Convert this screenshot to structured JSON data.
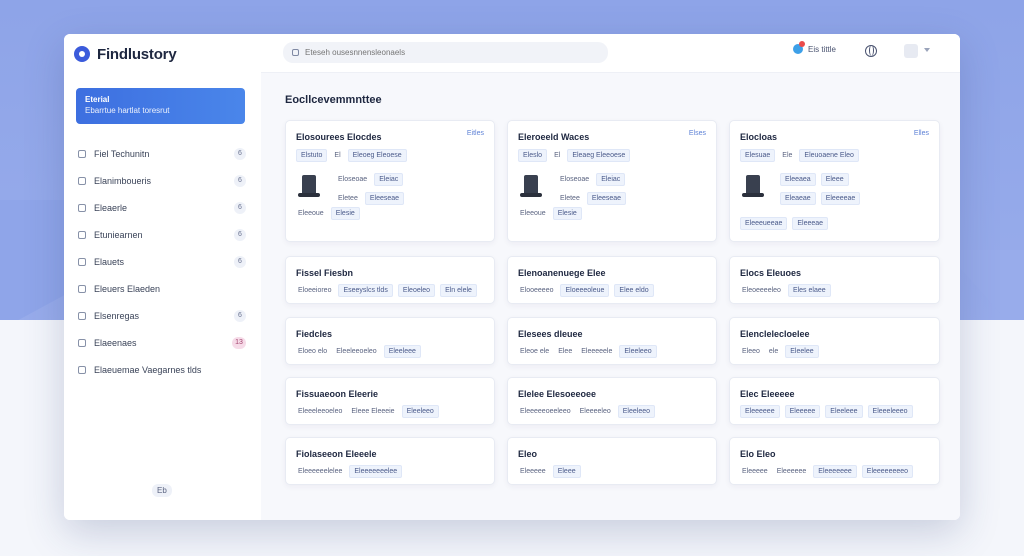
{
  "app": {
    "name": "Findlustory"
  },
  "sidebar": {
    "promo": {
      "title": "Eterial",
      "subtitle": "Ebarrtue hartlat toresrut"
    },
    "items": [
      {
        "label": "Fiel Techunitn",
        "count": "6"
      },
      {
        "label": "Elanimboueris",
        "count": "6"
      },
      {
        "label": "Eleaerle",
        "count": "6"
      },
      {
        "label": "Etuniearnen",
        "count": "6"
      },
      {
        "label": "Elauets",
        "count": "6"
      },
      {
        "label": "Eleuers Elaeden",
        "count": ""
      },
      {
        "label": "Elsenregas",
        "count": "6"
      },
      {
        "label": "Elaeenaes",
        "count": "13"
      },
      {
        "label": "Elaeuemae Vaegarnes tlds",
        "count": ""
      }
    ],
    "footer": "Eb"
  },
  "topbar": {
    "search_placeholder": "Eteseh ousesnnensleonaels",
    "notification_label": "Eis tittle"
  },
  "main": {
    "section_title": "Eocllcevemmnttee",
    "featured_cards": [
      {
        "title": "Elosourees Elocdes",
        "status": "Eitles",
        "tags": [
          "Elstuto",
          "El",
          "Eleoeg Eleoese"
        ],
        "meta": [
          [
            "Eloseoae",
            "Eleiac"
          ],
          [
            "Eletee",
            "Eleeseae"
          ]
        ],
        "footer_tags": [
          "Eleeoue",
          "Elesie"
        ]
      },
      {
        "title": "Eleroeeld Waces",
        "status": "Elses",
        "tags": [
          "Eleslo",
          "El",
          "Eleaeg Eleeoese"
        ],
        "meta": [
          [
            "Eloseoae",
            "Eleiac"
          ],
          [
            "Eletee",
            "Eleeseae"
          ]
        ],
        "footer_tags": [
          "Eleeoue",
          "Elesie"
        ]
      },
      {
        "title": "Elocloas",
        "status": "Elles",
        "tags": [
          "Elesuae",
          "Ele",
          "Eleuoaene Eleo"
        ],
        "meta": [
          [
            "Eleeaea",
            "Eleee"
          ],
          [
            "Eleaeae",
            "Eleeeeae"
          ]
        ],
        "footer_tags": [
          "Eleeeueeae",
          "Eleeeae"
        ]
      }
    ],
    "cards": [
      {
        "title": "Fissel Fiesbn",
        "tags": [
          "Eloeeioreo",
          "Eseeyslcs tlds",
          "Eleoeleo",
          "Eln elele"
        ]
      },
      {
        "title": "Elenoanenuege Elee",
        "tags": [
          "Elooeeeeo",
          "Eloeeeoleue",
          "Elee eldo"
        ]
      },
      {
        "title": "Elocs Eleuoes",
        "tags": [
          "Eleoeeeeleo",
          "Eles elaee"
        ]
      },
      {
        "title": "Fiedcles",
        "tags": [
          "Eloeo elo",
          "Eleeleeoeleo",
          "Eleeleee"
        ]
      },
      {
        "title": "Elesees dleuee",
        "tags": [
          "Eleoe ele",
          "Elee",
          "Eleeeeele",
          "Eleeleeo"
        ]
      },
      {
        "title": "Elenclelecloelee",
        "tags": [
          "Eleeo",
          "ele",
          "Eleelee"
        ]
      },
      {
        "title": "Fissuaeoon Eleerie",
        "tags": [
          "Eleeeleeoeleo",
          "Eleee Eleeeie",
          "Eleeleeo"
        ]
      },
      {
        "title": "Elelee Elesoeeoee",
        "tags": [
          "Eleeeeeoeeleeo",
          "Eleeeeleo",
          "Eleeleeo"
        ]
      },
      {
        "title": "Elec Eleeeee",
        "tags": [
          "Eleeeeee",
          "Eleeeee",
          "Eleeleee",
          "Eleeeleeeo"
        ]
      },
      {
        "title": "Fiolaseeon Eleeele",
        "tags": [
          "Eleeeeeelelee",
          "Eleeeeeeelee"
        ]
      },
      {
        "title": "Eleo",
        "tags": [
          "Eleeeee",
          "Eleee"
        ]
      },
      {
        "title": "Elo Eleo",
        "tags": [
          "Eleeeee",
          "Eleeeeee",
          "Eleeeeeee",
          "Eleeeeeeeeo"
        ]
      }
    ]
  }
}
